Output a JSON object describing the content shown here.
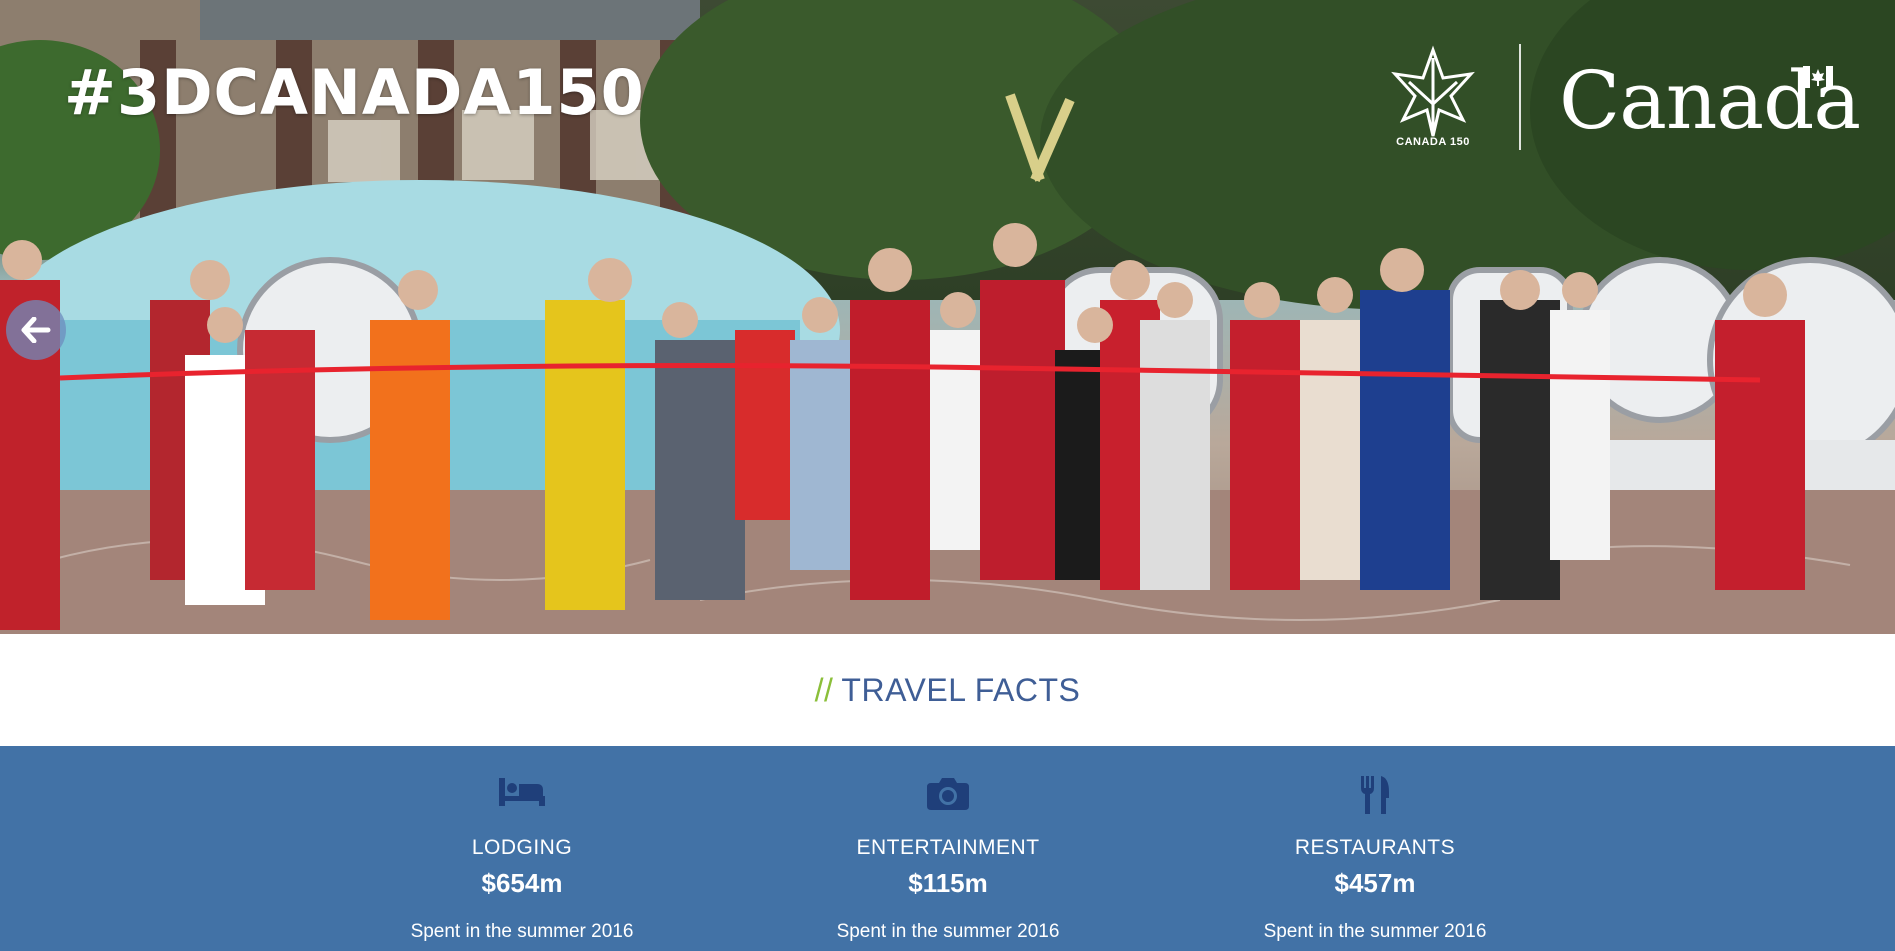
{
  "hero": {
    "hashtag": "#3DCANADA150",
    "canada150_label": "CANADA 150",
    "wordmark": "Canada",
    "prev_icon": "arrow-left-icon"
  },
  "section": {
    "slashes": "//",
    "title": "TRAVEL FACTS"
  },
  "facts": [
    {
      "icon": "bed-icon",
      "category": "LODGING",
      "amount": "$654m",
      "note": "Spent in the summer 2016"
    },
    {
      "icon": "camera-icon",
      "category": "ENTERTAINMENT",
      "amount": "$115m",
      "note": "Spent in the summer 2016"
    },
    {
      "icon": "utensils-icon",
      "category": "RESTAURANTS",
      "amount": "$457m",
      "note": "Spent in the summer 2016"
    }
  ],
  "colors": {
    "facts_bg": "#4272a6",
    "title_blue": "#3f5e96",
    "slash_green": "#8bbf3a",
    "icon_navy": "#1f3f7a"
  }
}
